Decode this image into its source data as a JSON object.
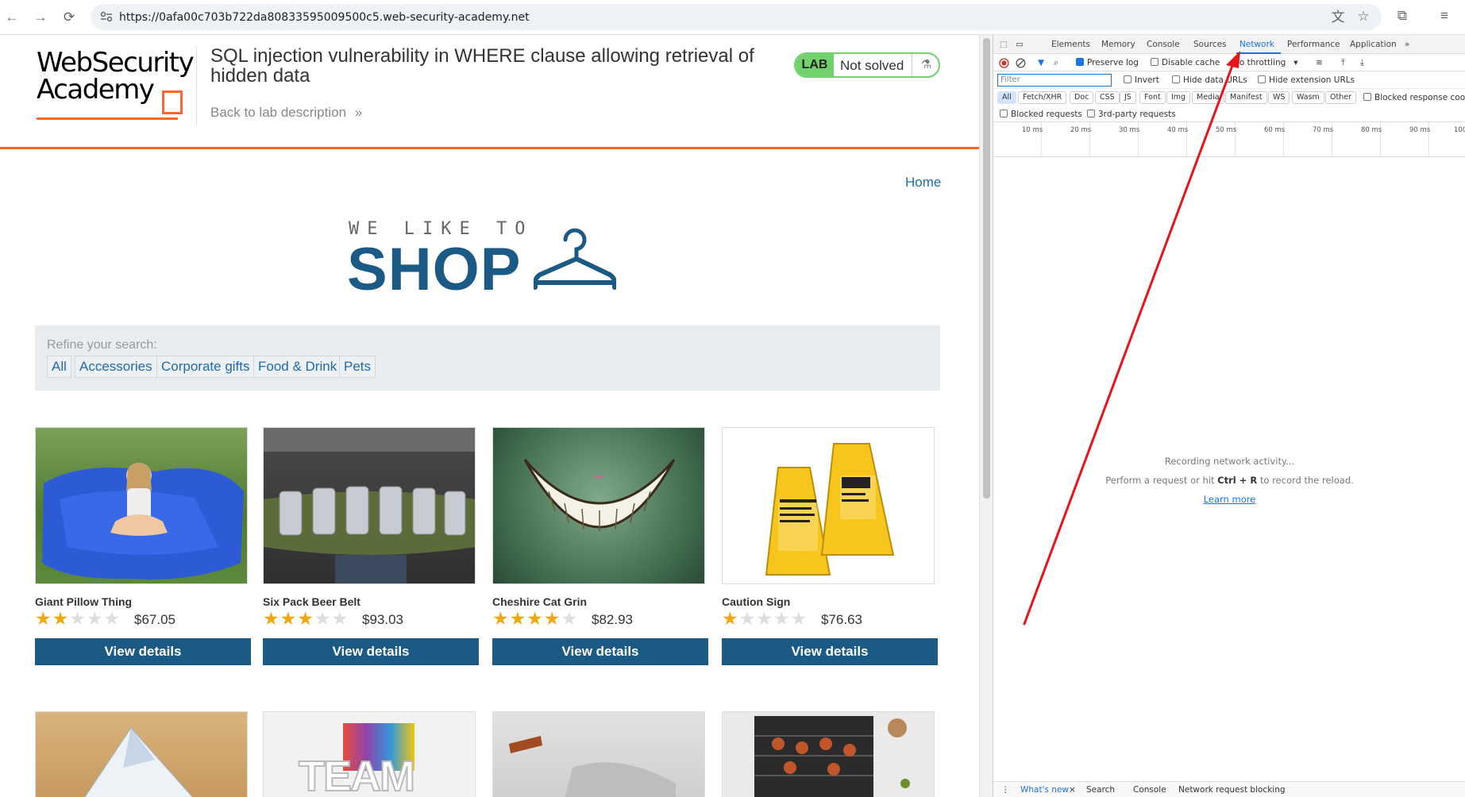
{
  "browser": {
    "url": "https://0afa00c703b722da80833595009500c5.web-security-academy.net"
  },
  "academy": {
    "logo_line1": "WebSecurity",
    "logo_line2": "Academy",
    "lab_title": "SQL injection vulnerability in WHERE clause allowing retrieval of hidden data",
    "back_link": "Back to lab description",
    "back_chevron": "»",
    "lab_label": "LAB",
    "lab_status": "Not solved",
    "accent_color": "#ff6633",
    "status_color": "#70d16d"
  },
  "shop": {
    "home_link": "Home",
    "logo_top": "WE LIKE TO",
    "logo_word": "SHOP",
    "refine_label": "Refine your search:",
    "filters": [
      "All",
      "Accessories",
      "Corporate gifts",
      "Food & Drink",
      "Pets"
    ],
    "button_color": "#1a5a85",
    "products": [
      {
        "name": "Giant Pillow Thing",
        "price": "$67.05",
        "rating": 2,
        "button": "View details"
      },
      {
        "name": "Six Pack Beer Belt",
        "price": "$93.03",
        "rating": 3,
        "button": "View details"
      },
      {
        "name": "Cheshire Cat Grin",
        "price": "$82.93",
        "rating": 4,
        "button": "View details"
      },
      {
        "name": "Caution Sign",
        "price": "$76.63",
        "rating": 1,
        "button": "View details"
      }
    ],
    "teaser_text": "TEAM"
  },
  "devtools": {
    "tabs": [
      "Elements",
      "Memory",
      "Console",
      "Sources",
      "Network",
      "Performance",
      "Application"
    ],
    "active_tab": "Network",
    "more_tabs": "»",
    "preserve_log": "Preserve log",
    "disable_cache": "Disable cache",
    "throttling": "No throttling",
    "filter_placeholder": "Filter",
    "invert": "Invert",
    "hide_data_urls": "Hide data URLs",
    "hide_extension_urls": "Hide extension URLs",
    "types": [
      "All",
      "Fetch/XHR",
      "Doc",
      "CSS",
      "JS",
      "Font",
      "Img",
      "Media",
      "Manifest",
      "WS",
      "Wasm",
      "Other"
    ],
    "blocked_response": "Blocked response cookies",
    "blocked_requests": "Blocked requests",
    "third_party": "3rd-party requests",
    "ticks": [
      "10 ms",
      "20 ms",
      "30 ms",
      "40 ms",
      "50 ms",
      "60 ms",
      "70 ms",
      "80 ms",
      "90 ms",
      "100"
    ],
    "empty_line1": "Recording network activity...",
    "empty_line2_a": "Perform a request or hit ",
    "empty_line2_b": "Ctrl + R",
    "empty_line2_c": " to record the reload.",
    "learn_more": "Learn more",
    "drawer": [
      "What's new",
      "Search",
      "Console",
      "Network request blocking"
    ],
    "drawer_close": "×"
  },
  "annotation_color": "#e8141b"
}
